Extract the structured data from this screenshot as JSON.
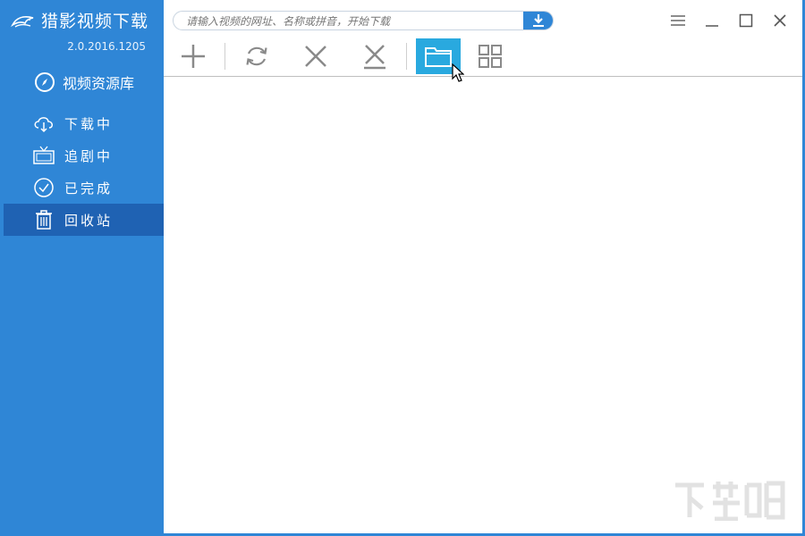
{
  "app": {
    "name": "猎影视频下载",
    "version": "2.0.2016.1205"
  },
  "sidebar": {
    "library_label": "视频资源库",
    "items": [
      {
        "label": "下载中",
        "icon": "cloud-download-icon"
      },
      {
        "label": "追剧中",
        "icon": "tv-icon"
      },
      {
        "label": "已完成",
        "icon": "check-circle-icon"
      },
      {
        "label": "回收站",
        "icon": "trash-icon",
        "active": true
      }
    ]
  },
  "search": {
    "placeholder": "请输入视频的网址、名称或拼音，开始下载",
    "value": ""
  },
  "toolbar": {
    "buttons": [
      {
        "name": "add",
        "icon": "plus-icon"
      },
      {
        "name": "refresh",
        "icon": "refresh-icon"
      },
      {
        "name": "delete",
        "icon": "x-icon"
      },
      {
        "name": "delete-all",
        "icon": "x-underline-icon"
      },
      {
        "name": "open-folder",
        "icon": "folder-icon",
        "active": true
      },
      {
        "name": "grid-view",
        "icon": "grid-icon"
      }
    ]
  },
  "colors": {
    "sidebar_bg": "#2f86d6",
    "sidebar_active": "#1f62b3",
    "toolbar_active": "#29a9df"
  }
}
